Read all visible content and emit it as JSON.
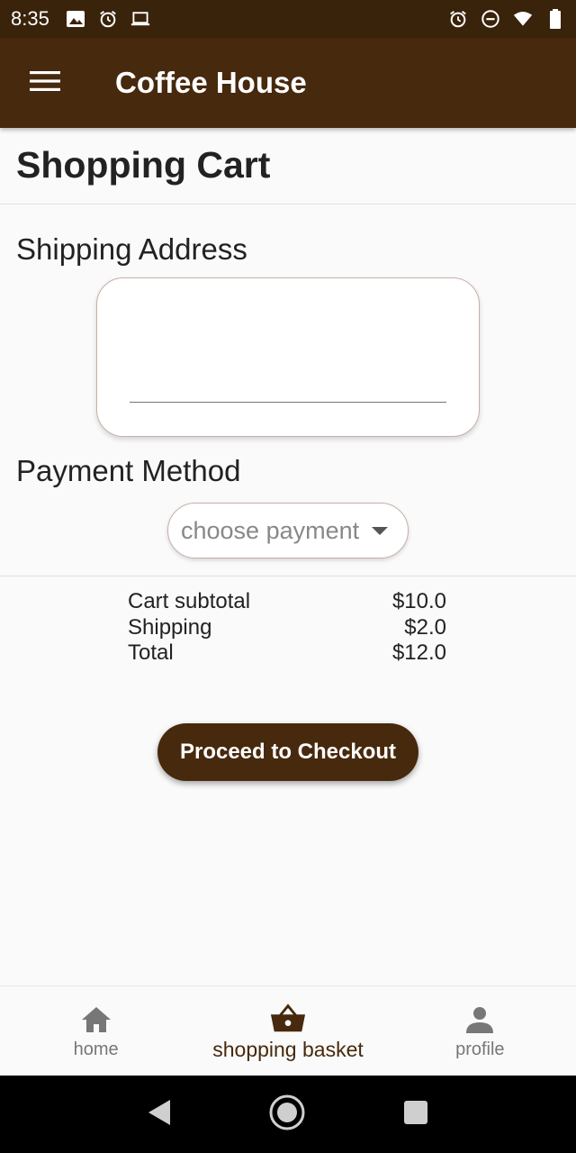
{
  "status_bar": {
    "time": "8:35",
    "left_icons": [
      "image-icon",
      "alarm-icon",
      "laptop-icon"
    ],
    "right_icons": [
      "alarm-icon",
      "do-not-disturb-icon",
      "wifi-icon",
      "battery-icon"
    ]
  },
  "app_bar": {
    "title": "Coffee House",
    "menu_icon": "menu-icon",
    "background": "#47290d"
  },
  "page": {
    "title": "Shopping Cart"
  },
  "shipping": {
    "label": "Shipping Address",
    "value": ""
  },
  "payment": {
    "label": "Payment Method",
    "placeholder": "choose payment"
  },
  "summary": {
    "rows": [
      {
        "label": "Cart subtotal",
        "value": "$10.0"
      },
      {
        "label": "Shipping",
        "value": "$2.0"
      },
      {
        "label": "Total",
        "value": "$12.0"
      }
    ]
  },
  "checkout": {
    "label": "Proceed to Checkout"
  },
  "bottom_nav": {
    "items": [
      {
        "label": "home",
        "icon": "home-icon",
        "active": false
      },
      {
        "label": "shopping basket",
        "icon": "basket-icon",
        "active": true
      },
      {
        "label": "profile",
        "icon": "person-icon",
        "active": false
      }
    ]
  },
  "colors": {
    "status_bar": "#3a230b",
    "accent": "#47290d",
    "inactive": "#777777"
  }
}
